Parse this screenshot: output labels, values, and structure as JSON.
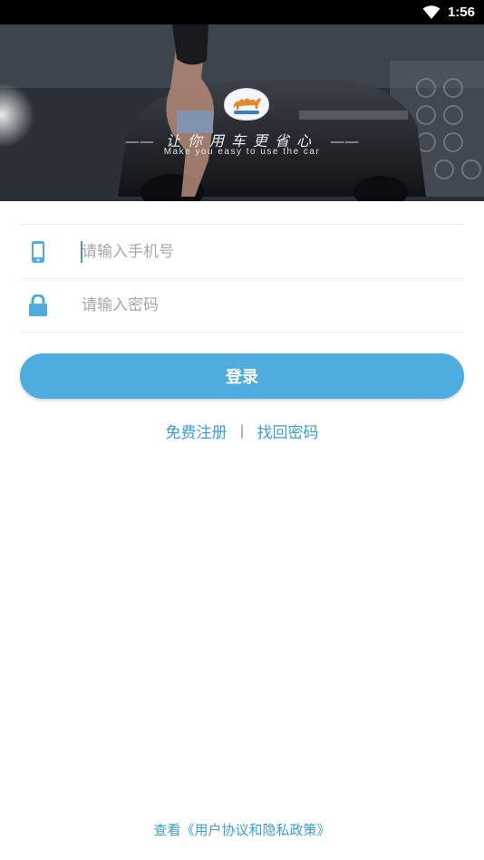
{
  "status_bar": {
    "time": "1:56",
    "icons": [
      "wifi-icon"
    ]
  },
  "banner": {
    "slogan_cn": "让你用车更省心",
    "slogan_dash": "——",
    "slogan_en": "Make you easy to use the car",
    "logo": "camel-logo"
  },
  "form": {
    "phone": {
      "placeholder": "请输入手机号",
      "value": "",
      "icon": "phone-icon"
    },
    "password": {
      "placeholder": "请输入密码",
      "value": "",
      "icon": "lock-icon"
    }
  },
  "login_button": {
    "label": "登录"
  },
  "links": {
    "register": "免费注册",
    "separator": "|",
    "forgot": "找回密码"
  },
  "agreement": {
    "text": "查看《用户协议和隐私政策》"
  },
  "colors": {
    "accent": "#4eadde",
    "link": "#3a9ed8",
    "placeholder": "#a7a7a7",
    "divider": "#ececec"
  }
}
